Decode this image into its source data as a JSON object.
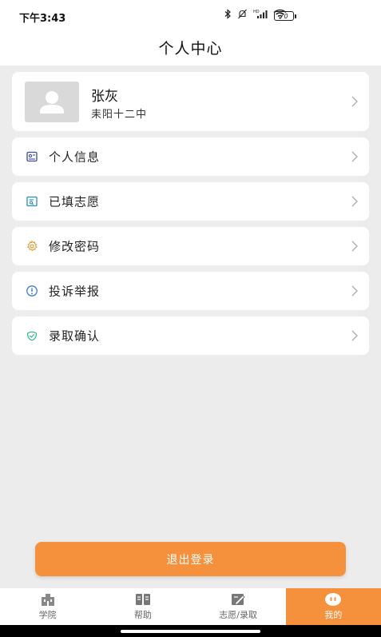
{
  "status_bar": {
    "time": "下午3:43",
    "battery": "70"
  },
  "header": {
    "title": "个人中心"
  },
  "profile": {
    "name": "张灰",
    "school": "耒阳十二中"
  },
  "menu": [
    {
      "label": "个人信息",
      "icon": "id-card-icon",
      "color": "#3b4a9a"
    },
    {
      "label": "已填志愿",
      "icon": "form-search-icon",
      "color": "#2a8fb5"
    },
    {
      "label": "修改密码",
      "icon": "gear-icon",
      "color": "#d9a441"
    },
    {
      "label": "投诉举报",
      "icon": "alert-circle-icon",
      "color": "#3a7bc8"
    },
    {
      "label": "录取确认",
      "icon": "check-shield-icon",
      "color": "#37b48a"
    }
  ],
  "logout_label": "退出登录",
  "tabs": [
    {
      "label": "学院",
      "icon": "college-icon",
      "active": false
    },
    {
      "label": "帮助",
      "icon": "book-icon",
      "active": false
    },
    {
      "label": "志愿/录取",
      "icon": "edit-icon",
      "active": false
    },
    {
      "label": "我的",
      "icon": "profile-face-icon",
      "active": true
    }
  ],
  "colors": {
    "accent": "#f5913c",
    "background": "#ececec",
    "card": "#ffffff"
  }
}
